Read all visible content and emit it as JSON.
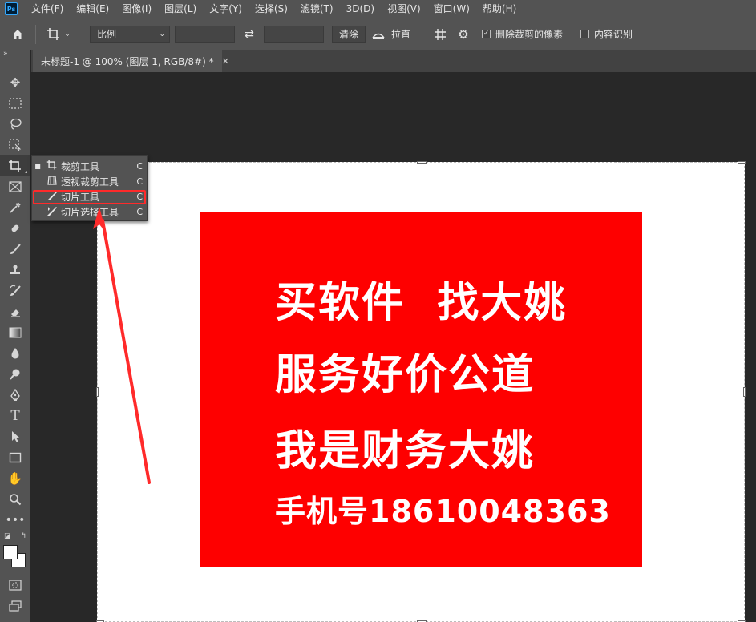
{
  "app": {
    "logo": "Ps",
    "menu": [
      "文件(F)",
      "编辑(E)",
      "图像(I)",
      "图层(L)",
      "文字(Y)",
      "选择(S)",
      "滤镜(T)",
      "3D(D)",
      "视图(V)",
      "窗口(W)",
      "帮助(H)"
    ]
  },
  "options": {
    "ratio_select": "比例",
    "width_value": "",
    "height_value": "",
    "clear_label": "清除",
    "straighten_label": "拉直",
    "delete_cropped_label": "删除裁剪的像素",
    "delete_cropped_checked": true,
    "content_aware_label": "内容识别",
    "content_aware_checked": false
  },
  "document": {
    "tab_title": "未标题-1 @ 100% (图层 1, RGB/8#) *"
  },
  "flyout": {
    "items": [
      {
        "label": "裁剪工具",
        "key": "C",
        "icon": "crop-icon",
        "selected": true
      },
      {
        "label": "透视裁剪工具",
        "key": "C",
        "icon": "perspective-crop-icon",
        "selected": false
      },
      {
        "label": "切片工具",
        "key": "C",
        "icon": "slice-icon",
        "selected": false,
        "highlighted": true
      },
      {
        "label": "切片选择工具",
        "key": "C",
        "icon": "slice-select-icon",
        "selected": false
      }
    ]
  },
  "canvas": {
    "lines": [
      "买软件  找大姚",
      "服务好价公道",
      "我是财务大姚",
      "手机号18610048363"
    ],
    "red_color": "#fe0000",
    "text_color": "#ffffff"
  },
  "colors": {
    "panel": "#535353",
    "workspace": "#282828",
    "highlight": "#ff2a2a"
  },
  "tools": [
    "move-icon",
    "marquee-icon",
    "lasso-icon",
    "object-select-icon",
    "crop-icon",
    "frame-icon",
    "eyedropper-icon",
    "healing-icon",
    "brush-icon",
    "stamp-icon",
    "history-brush-icon",
    "eraser-icon",
    "gradient-icon",
    "blur-icon",
    "dodge-icon",
    "pen-icon",
    "type-icon",
    "path-select-icon",
    "rectangle-icon",
    "hand-icon",
    "zoom-icon",
    "more-icon",
    "color-swap-icon",
    "color-swatch",
    "quick-mask-icon",
    "screen-mode-icon"
  ]
}
